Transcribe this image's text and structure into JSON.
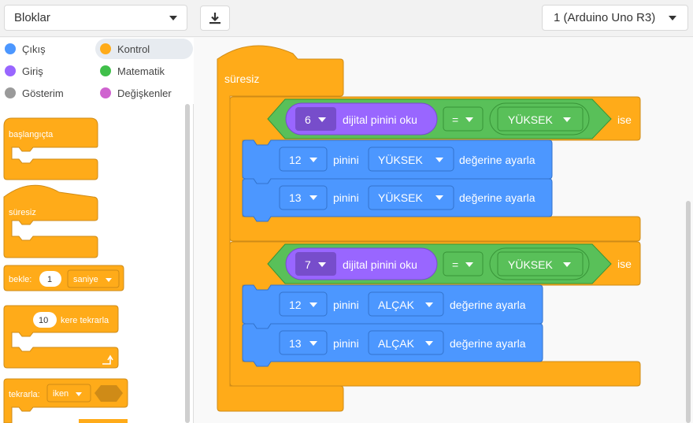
{
  "toolbox": {
    "dropdown_label": "Bloklar"
  },
  "toolbar": {
    "download_icon": "download-icon",
    "board_label": "1 (Arduino Uno R3)"
  },
  "categories": [
    {
      "label": "Çıkış",
      "color": "#4c97ff"
    },
    {
      "label": "Kontrol",
      "color": "#ffab19"
    },
    {
      "label": "Giriş",
      "color": "#9966ff"
    },
    {
      "label": "Matematik",
      "color": "#40bf4a"
    },
    {
      "label": "Gösterim",
      "color": "#9a9a9a"
    },
    {
      "label": "Değişkenler",
      "color": "#cf63cf"
    }
  ],
  "palette": {
    "start_label": "başlangıçta",
    "forever_label": "süresiz",
    "wait_label": "bekle:",
    "wait_value": "1",
    "wait_unit": "saniye",
    "repeat_value": "10",
    "repeat_label": "kere tekrarla",
    "repeat_while_label": "tekrarla:",
    "repeat_while_mode": "iken"
  },
  "script": {
    "forever_label": "süresiz",
    "if1": {
      "pin": "6",
      "read_label": "dijital pinini oku",
      "op": "=",
      "value": "YÜKSEK",
      "then_label": "ise",
      "set1": {
        "pin": "12",
        "pin_label": "pinini",
        "value": "YÜKSEK",
        "set_label": "değerine ayarla"
      },
      "set2": {
        "pin": "13",
        "pin_label": "pinini",
        "value": "YÜKSEK",
        "set_label": "değerine ayarla"
      }
    },
    "if2": {
      "pin": "7",
      "read_label": "dijital pinini oku",
      "op": "=",
      "value": "YÜKSEK",
      "then_label": "ise",
      "set1": {
        "pin": "12",
        "pin_label": "pinini",
        "value": "ALÇAK",
        "set_label": "değerine ayarla"
      },
      "set2": {
        "pin": "13",
        "pin_label": "pinini",
        "value": "ALÇAK",
        "set_label": "değerine ayarla"
      }
    }
  },
  "colors": {
    "control": "#ffab19",
    "control_dark": "#cf8b17",
    "output": "#4c97ff",
    "output_dark": "#3373cc",
    "input": "#9966ff",
    "input_dark": "#774dcb",
    "math": "#59c059",
    "math_dark": "#389438"
  }
}
